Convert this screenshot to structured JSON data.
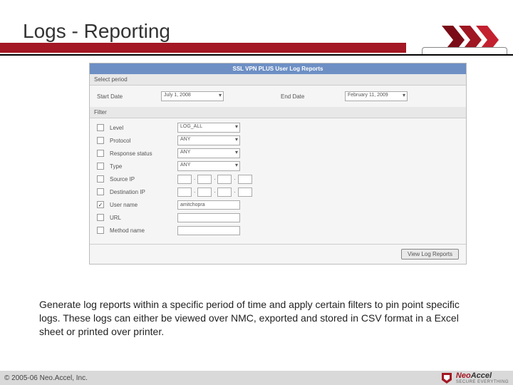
{
  "slide": {
    "title": "Logs - Reporting",
    "description": "Generate log reports within a specific period of time and apply certain filters to pin point specific logs. These logs can either be viewed over NMC, exported and stored in CSV format in a Excel sheet or printed over printer.",
    "copyright": "© 2005-06 Neo.Accel, Inc."
  },
  "app": {
    "title": "SSL VPN PLUS User Log Reports",
    "period_section": "Select period",
    "start_label": "Start Date",
    "start_value": "July 1, 2008",
    "end_label": "End Date",
    "end_value": "February 11, 2009",
    "filter_section": "Filter",
    "filters": {
      "level": {
        "label": "Level",
        "value": "LOG_ALL"
      },
      "protocol": {
        "label": "Protocol",
        "value": "ANY"
      },
      "response": {
        "label": "Response status",
        "value": "ANY"
      },
      "type": {
        "label": "Type",
        "value": "ANY"
      },
      "srcip": {
        "label": "Source IP"
      },
      "dstip": {
        "label": "Destination IP"
      },
      "user": {
        "label": "User name",
        "value": "amitchopra",
        "checked": true
      },
      "url": {
        "label": "URL"
      },
      "method": {
        "label": "Method name"
      }
    },
    "button": "View Log Reports"
  },
  "brand": {
    "name1": "Neo",
    "name2": "Accel",
    "tagline": "SECURE EVERYTHING"
  }
}
